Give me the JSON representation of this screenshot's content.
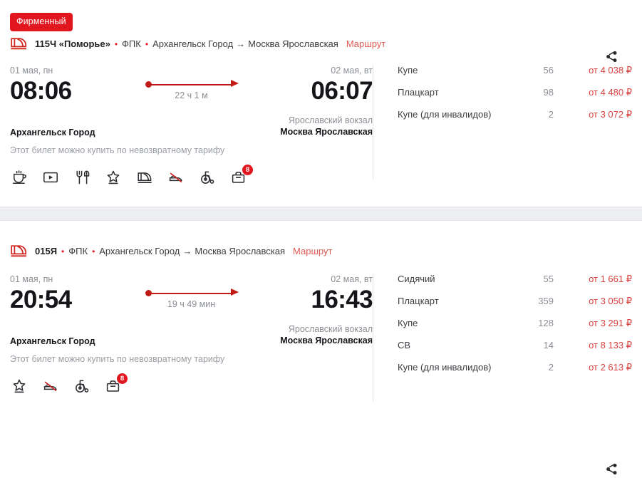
{
  "accent": {
    "brand_red": "#e2161e",
    "line_red": "#c21a16",
    "price_red": "#d9423f",
    "link_red": "#e05a52",
    "muted_gray": "#8b8f95",
    "band_gray": "#eceef0"
  },
  "cards": [
    {
      "badge": "Фирменный",
      "train_icon": "train-front-icon",
      "train_number": "115Ч «Поморье»",
      "separator": "•",
      "carrier": "ФПК",
      "origin": "Архангельск Город",
      "arrow": "→",
      "destination": "Москва Ярославская",
      "route_link": "Маршрут",
      "share_icon": "share-icon",
      "departure": {
        "date": "01 мая, пн",
        "time": "08:06",
        "station_sub": "",
        "station_main": "Архангельск Город"
      },
      "arrival": {
        "date": "02 мая, вт",
        "time": "06:07",
        "station_sub": "Ярославский вокзал",
        "station_main": "Москва Ярославская"
      },
      "duration": "22 ч 1 м",
      "tariff_note": "Этот билет можно купить по невозвратному тарифу",
      "amenities": [
        {
          "icon": "hot-drink-icon",
          "badge": ""
        },
        {
          "icon": "video-player-icon",
          "badge": ""
        },
        {
          "icon": "meal-cutlery-icon",
          "badge": ""
        },
        {
          "icon": "star-service-icon",
          "badge": ""
        },
        {
          "icon": "train-car-icon",
          "badge": ""
        },
        {
          "icon": "no-bedding-icon",
          "badge": ""
        },
        {
          "icon": "wheelchair-accessible-icon",
          "badge": ""
        },
        {
          "icon": "luggage-icon",
          "badge": "8"
        }
      ],
      "prices": [
        {
          "class": "Купе",
          "seats": "56",
          "price": "от 4 038 ₽"
        },
        {
          "class": "Плацкарт",
          "seats": "98",
          "price": "от 4 480 ₽"
        },
        {
          "class": "Купе (для инвалидов)",
          "seats": "2",
          "price": "от 3 072 ₽"
        }
      ]
    },
    {
      "badge": "",
      "train_icon": "train-front-icon",
      "train_number": "015Я",
      "separator": "•",
      "carrier": "ФПК",
      "origin": "Архангельск Город",
      "arrow": "→",
      "destination": "Москва Ярославская",
      "route_link": "Маршрут",
      "share_icon": "share-icon",
      "departure": {
        "date": "01 мая, пн",
        "time": "20:54",
        "station_sub": "",
        "station_main": "Архангельск Город"
      },
      "arrival": {
        "date": "02 мая, вт",
        "time": "16:43",
        "station_sub": "Ярославский вокзал",
        "station_main": "Москва Ярославская"
      },
      "duration": "19 ч 49 мин",
      "tariff_note": "Этот билет можно купить по невозвратному тарифу",
      "amenities": [
        {
          "icon": "star-service-icon",
          "badge": ""
        },
        {
          "icon": "no-bedding-icon",
          "badge": ""
        },
        {
          "icon": "wheelchair-accessible-icon",
          "badge": ""
        },
        {
          "icon": "luggage-icon",
          "badge": "8"
        }
      ],
      "prices": [
        {
          "class": "Сидячий",
          "seats": "55",
          "price": "от 1 661 ₽"
        },
        {
          "class": "Плацкарт",
          "seats": "359",
          "price": "от 3 050 ₽"
        },
        {
          "class": "Купе",
          "seats": "128",
          "price": "от 3 291 ₽"
        },
        {
          "class": "СВ",
          "seats": "14",
          "price": "от 8 133 ₽"
        },
        {
          "class": "Купе (для инвалидов)",
          "seats": "2",
          "price": "от 2 613 ₽"
        }
      ]
    }
  ]
}
